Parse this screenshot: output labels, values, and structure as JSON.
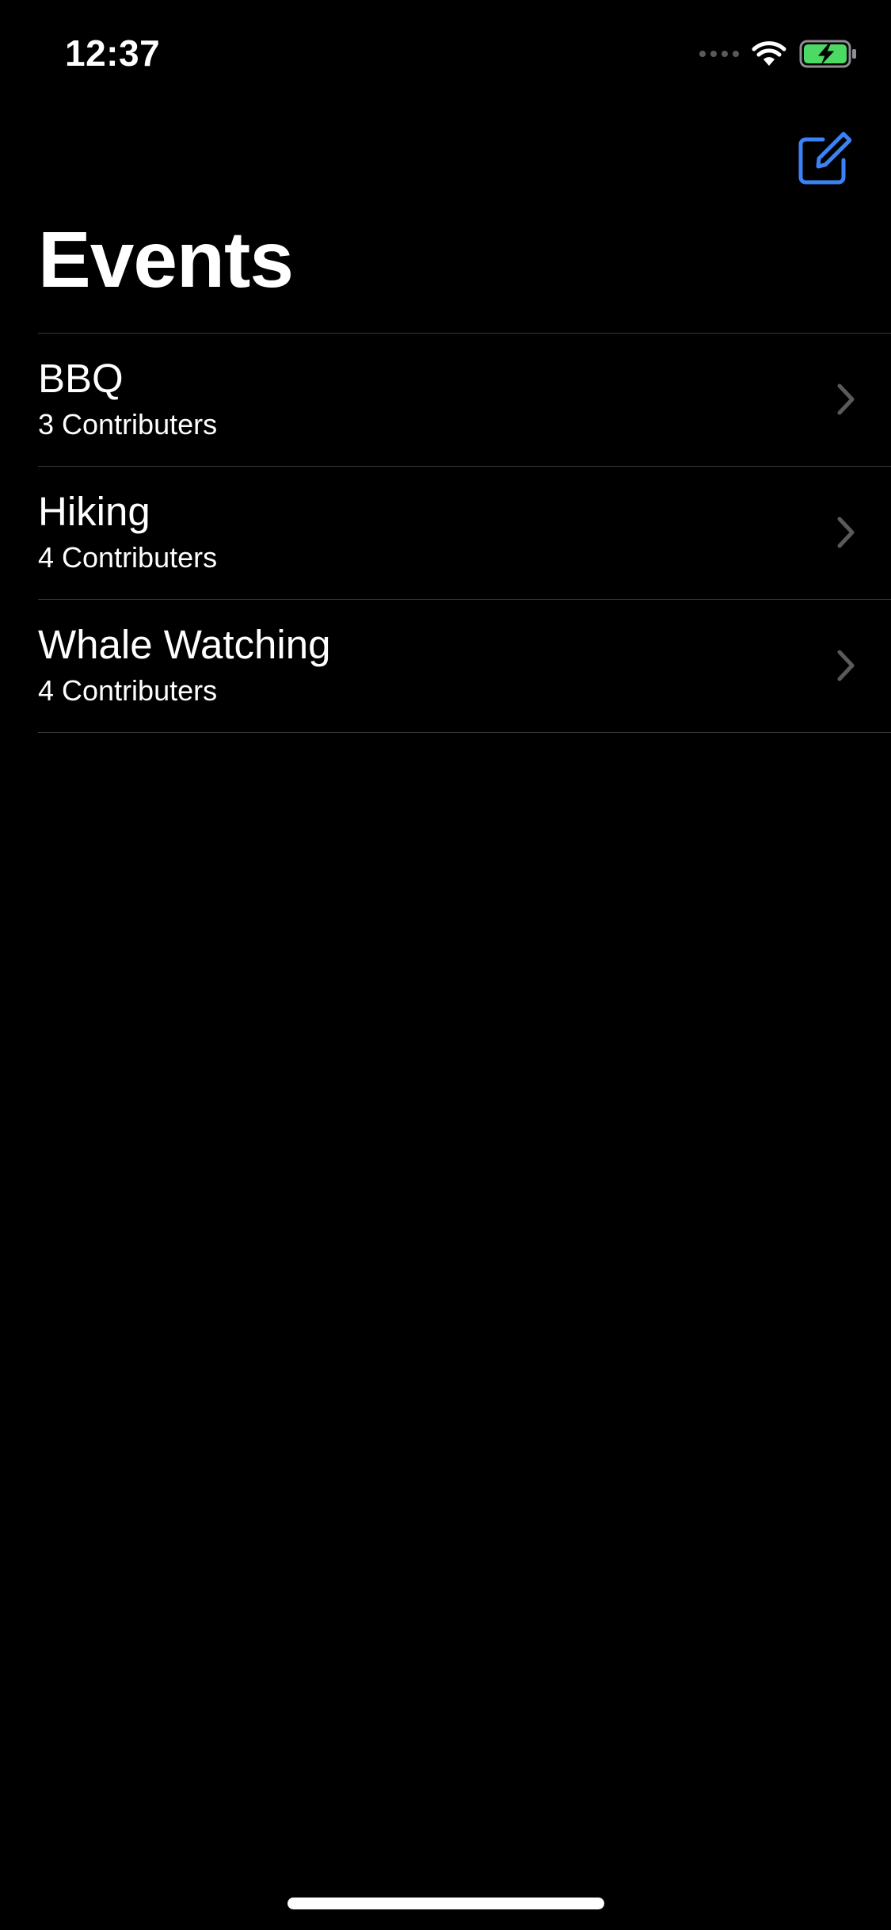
{
  "status_bar": {
    "time": "12:37",
    "signal_icon": "cellular-dots-icon",
    "wifi_icon": "wifi-icon",
    "battery_icon": "battery-charging-icon",
    "battery_color": "#4cd964"
  },
  "nav_bar": {
    "compose_icon": "compose-icon",
    "accent_color": "#3b82f6"
  },
  "title": "Events",
  "events": [
    {
      "title": "BBQ",
      "subtitle": "3 Contributers"
    },
    {
      "title": "Hiking",
      "subtitle": "4 Contributers"
    },
    {
      "title": "Whale Watching",
      "subtitle": "4 Contributers"
    }
  ]
}
